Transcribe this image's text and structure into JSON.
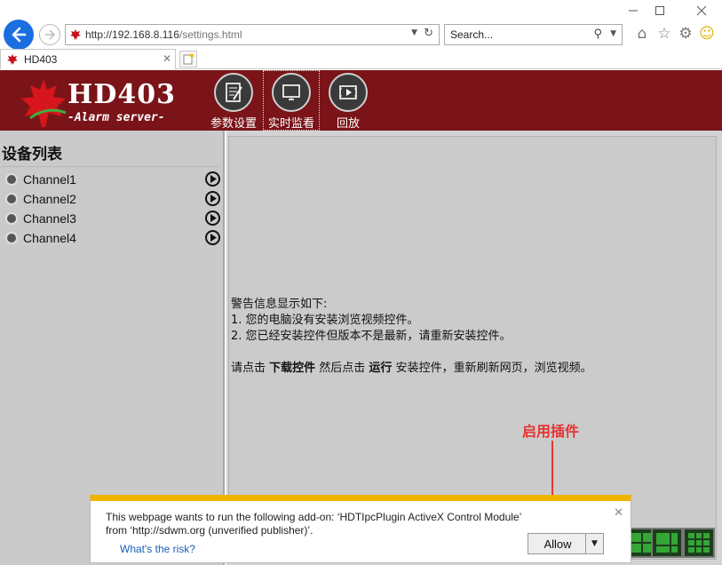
{
  "browser": {
    "url_host": "http://192.168.8.116",
    "url_path": "/settings.html",
    "search_placeholder": "Search...",
    "tab_title": "HD403"
  },
  "app": {
    "brand": "HD403",
    "subtitle": "-Alarm server-",
    "nav": [
      {
        "label": "参数设置",
        "icon": "settings-doc-icon"
      },
      {
        "label": "实时监看",
        "icon": "monitor-icon"
      },
      {
        "label": "回放",
        "icon": "playback-icon"
      }
    ]
  },
  "sidebar": {
    "title": "设备列表",
    "channels": [
      "Channel1",
      "Channel2",
      "Channel3",
      "Channel4"
    ]
  },
  "main": {
    "warning_title": "警告信息显示如下:",
    "warning_1": "1. 您的电脑没有安装浏览视频控件。",
    "warning_2": "2. 您已经安装控件但版本不是最新，请重新安装控件。",
    "instr_a": "请点击 ",
    "instr_download": "下载控件",
    "instr_b": " 然后点击 ",
    "instr_run": "运行",
    "instr_c": " 安装控件，重新刷新网页，浏览视频。"
  },
  "annotation": {
    "text": "启用插件",
    "color": "#e63333"
  },
  "notification": {
    "message": "This webpage wants to run the following add-on: ‘HDTIpcPlugin ActiveX Control Module’ from ‘http://sdwm.org (unverified publisher)’.",
    "risk_link": "What's the risk?",
    "allow_label": "Allow",
    "bar_color": "#f0b400"
  },
  "colors": {
    "header": "#7a1418",
    "panel": "#cacaca"
  }
}
